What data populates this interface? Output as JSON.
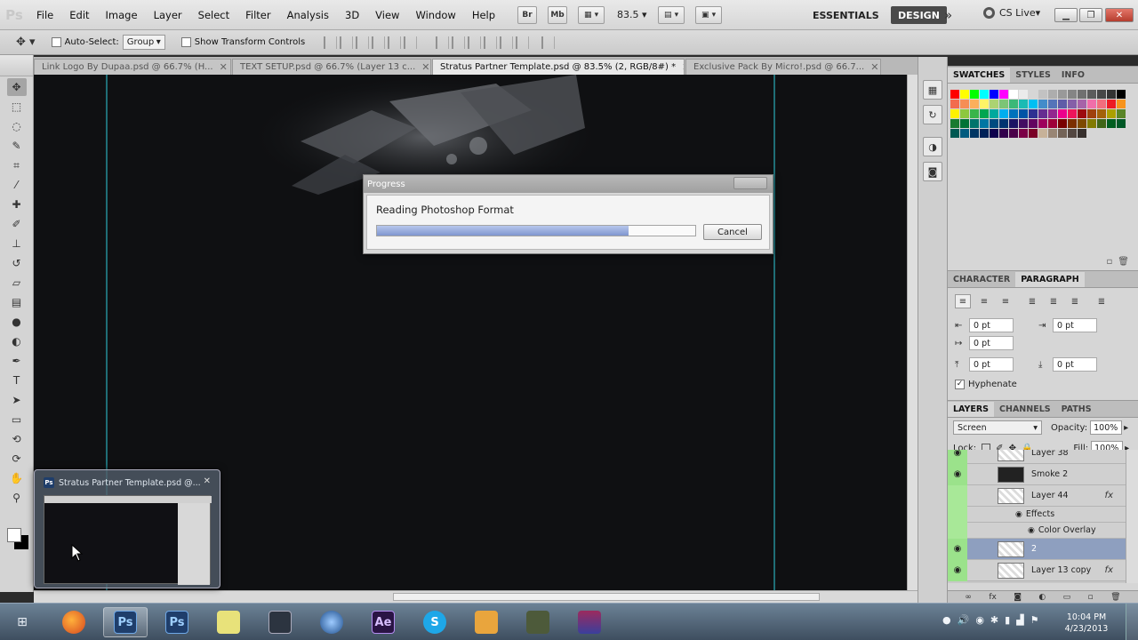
{
  "app": {
    "logo": "Ps"
  },
  "menu": [
    "File",
    "Edit",
    "Image",
    "Layer",
    "Select",
    "Filter",
    "Analysis",
    "3D",
    "View",
    "Window",
    "Help"
  ],
  "menubar": {
    "br_label": "Br",
    "mb_label": "Mb",
    "zoom": "83.5",
    "workspace_essentials": "ESSENTIALS",
    "workspace_design": "DESIGN",
    "cs_live": "CS Live"
  },
  "options": {
    "auto_select_label": "Auto-Select:",
    "auto_select_value": "Group",
    "transform_label": "Show Transform Controls"
  },
  "tabs": [
    {
      "label": "Link Logo By Dupaa.psd @ 66.7% (H..."
    },
    {
      "label": "TEXT SETUP.psd @ 66.7% (Layer 13 c..."
    },
    {
      "label": "Stratus Partner Template.psd @ 83.5% (2, RGB/8#) *"
    },
    {
      "label": "Exclusive Pack By Micro!.psd @ 66.7..."
    }
  ],
  "dialog": {
    "title": "Progress",
    "message": "Reading Photoshop Format",
    "progress": 0.79,
    "cancel_label": "Cancel"
  },
  "swatches_panel": {
    "tabs": [
      "SWATCHES",
      "STYLES",
      "INFO"
    ],
    "colors": [
      "#ff0000",
      "#ffff00",
      "#00ff00",
      "#00ffff",
      "#0000ff",
      "#ff00ff",
      "#ffffff",
      "#ebebeb",
      "#d6d6d6",
      "#c2c2c2",
      "#adadad",
      "#999999",
      "#858585",
      "#707070",
      "#5c5c5c",
      "#474747",
      "#333333",
      "#000000",
      "#f26c4f",
      "#f68e55",
      "#fbaf5c",
      "#fff467",
      "#acd372",
      "#7cc576",
      "#3bb878",
      "#1abbb4",
      "#00bff3",
      "#438cca",
      "#5574b9",
      "#605ca8",
      "#855fa8",
      "#a763a8",
      "#f06ea9",
      "#f26d7d",
      "#ed1c24",
      "#f7941d",
      "#fff200",
      "#8dc73f",
      "#39b54a",
      "#00a650",
      "#00a99d",
      "#00aeef",
      "#0072bc",
      "#0054a6",
      "#2e3192",
      "#662d91",
      "#92278f",
      "#ec008c",
      "#ed145b",
      "#9e0b0f",
      "#a0410d",
      "#a36209",
      "#aba000",
      "#598527",
      "#1a7b30",
      "#007236",
      "#00746b",
      "#0076a3",
      "#004b80",
      "#003471",
      "#1b1464",
      "#440e62",
      "#630460",
      "#9e005d",
      "#9e0039",
      "#790000",
      "#7b2e00",
      "#7d4900",
      "#827b00",
      "#406618",
      "#005e20",
      "#005826",
      "#005952",
      "#005b7f",
      "#003663",
      "#002157",
      "#0d004c",
      "#32004b",
      "#4b0049",
      "#7b0046",
      "#7a0026",
      "#c7b299",
      "#998675",
      "#736357",
      "#534741",
      "#37302d"
    ]
  },
  "paragraph_panel": {
    "tabs": [
      "CHARACTER",
      "PARAGRAPH"
    ],
    "indent_left": "0 pt",
    "indent_right": "0 pt",
    "indent_first": "0 pt",
    "space_before": "0 pt",
    "space_after": "0 pt",
    "hyphenate_label": "Hyphenate"
  },
  "layers_panel": {
    "tabs": [
      "LAYERS",
      "CHANNELS",
      "PATHS"
    ],
    "blend_mode": "Screen",
    "opacity_label": "Opacity:",
    "opacity": "100%",
    "lock_label": "Lock:",
    "fill_label": "Fill:",
    "fill": "100%",
    "layers": [
      {
        "name": "Layer 38",
        "fx": ""
      },
      {
        "name": "Smoke 2",
        "fx": ""
      },
      {
        "name": "Layer 44",
        "fx": "fx"
      },
      {
        "name": "Effects",
        "fx": ""
      },
      {
        "name": "Color Overlay",
        "fx": ""
      },
      {
        "name": "2",
        "fx": ""
      },
      {
        "name": "Layer 13 copy",
        "fx": "fx"
      }
    ]
  },
  "preview": {
    "title": "Stratus Partner Template.psd @..."
  },
  "taskbar": {
    "apps": [
      "firefox",
      "photoshop",
      "photoshop",
      "notes",
      "screen",
      "cinema4d",
      "aftereffects",
      "skype",
      "explorer",
      "media",
      "winrar"
    ],
    "ps_label": "Ps",
    "ae_label": "Ae",
    "time": "10:04 PM",
    "date": "4/23/2013"
  }
}
